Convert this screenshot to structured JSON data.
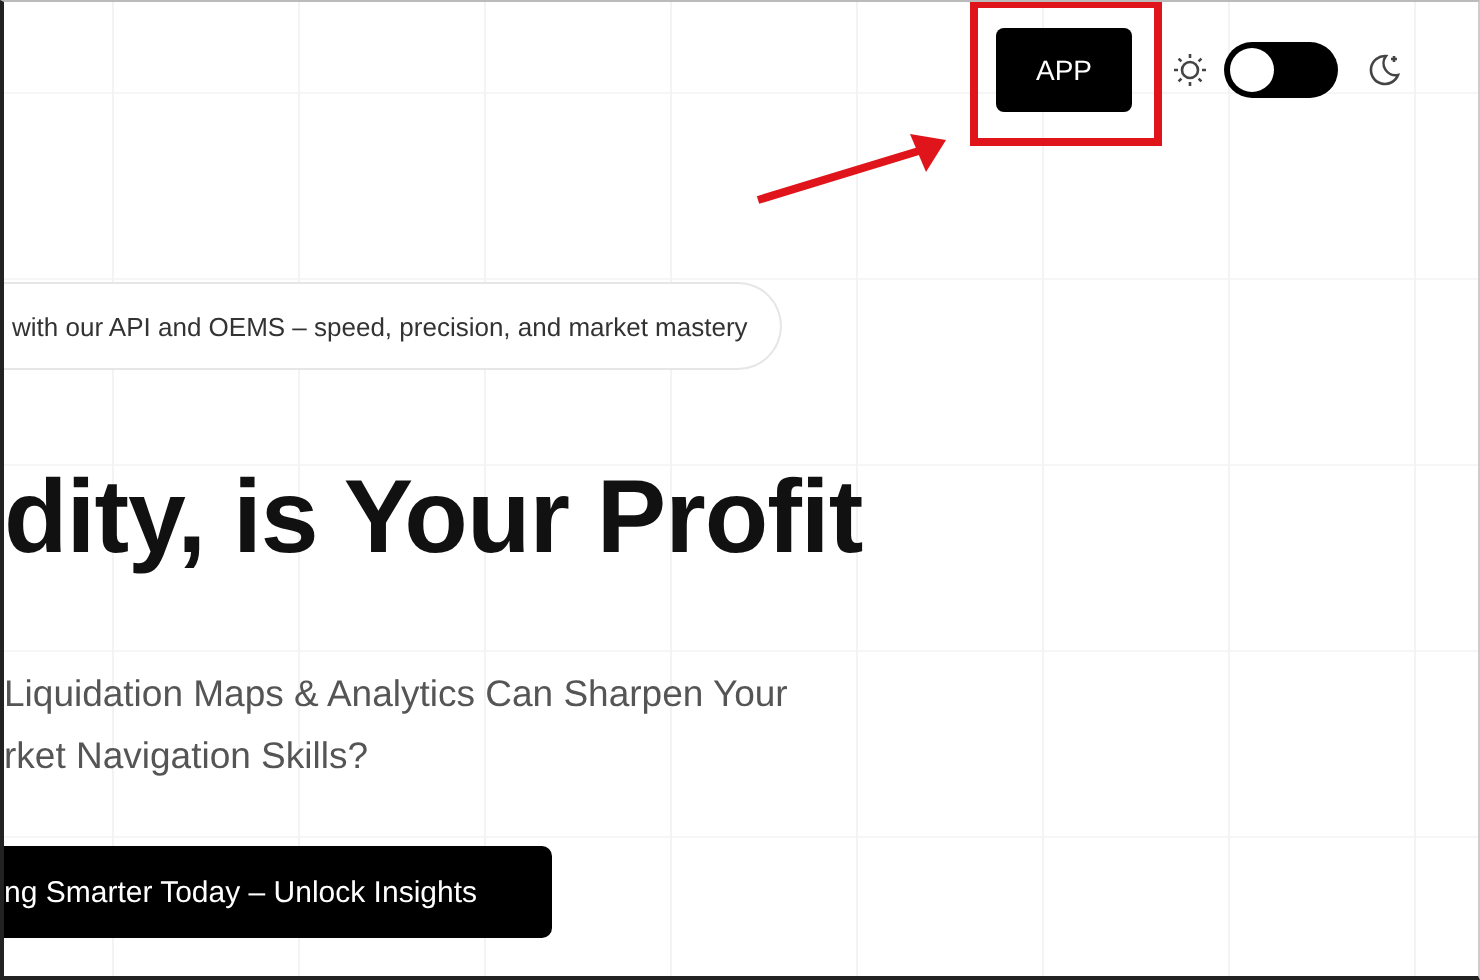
{
  "header": {
    "app_button": "APP",
    "theme_toggle": {
      "on": false
    }
  },
  "announcement": "with our API and OEMS – speed, precision, and market mastery",
  "headline": "dity, is Your Profit",
  "subtitle": [
    "Liquidation Maps & Analytics Can Sharpen Your",
    "rket Navigation Skills?"
  ],
  "cta_button": "ng Smarter Today – Unlock Insights"
}
